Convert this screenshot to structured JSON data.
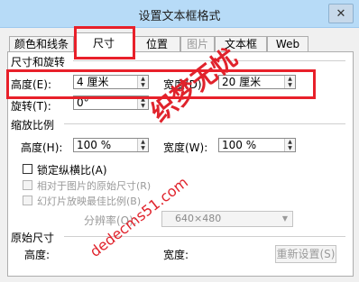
{
  "window": {
    "title": "设置文本框格式",
    "close_glyph": "✕"
  },
  "tabs": [
    {
      "label": "颜色和线条",
      "state": "normal"
    },
    {
      "label": "尺寸",
      "state": "active"
    },
    {
      "label": "位置",
      "state": "normal"
    },
    {
      "label": "图片",
      "state": "disabled"
    },
    {
      "label": "文本框",
      "state": "normal"
    },
    {
      "label": "Web",
      "state": "normal"
    }
  ],
  "size_rotate": {
    "section_title": "尺寸和旋转",
    "height_label": "高度(E):",
    "height_value": "4 厘米",
    "width_label": "宽度(D):",
    "width_value": "20 厘米",
    "rotation_label": "旋转(T):",
    "rotation_value": "0°"
  },
  "scale": {
    "section_title": "缩放比例",
    "height_label": "高度(H):",
    "height_value": "100 %",
    "width_label": "宽度(W):",
    "width_value": "100 %",
    "lock_aspect_label": "锁定纵横比(A)",
    "relative_original_label": "相对于图片的原始尺寸(R)",
    "best_slideshow_label": "幻灯片放映最佳比例(B)",
    "resolution_label": "分辨率(O):",
    "resolution_value": "640×480"
  },
  "original_size": {
    "section_title": "原始尺寸",
    "height_label": "高度:",
    "width_label": "宽度:",
    "reset_button": "重新设置(S)"
  },
  "watermark": {
    "text_main": "织梦无忧",
    "text_url": "dedecms51.com",
    "color": "#e0232c"
  },
  "highlight_color": "#e8202a"
}
